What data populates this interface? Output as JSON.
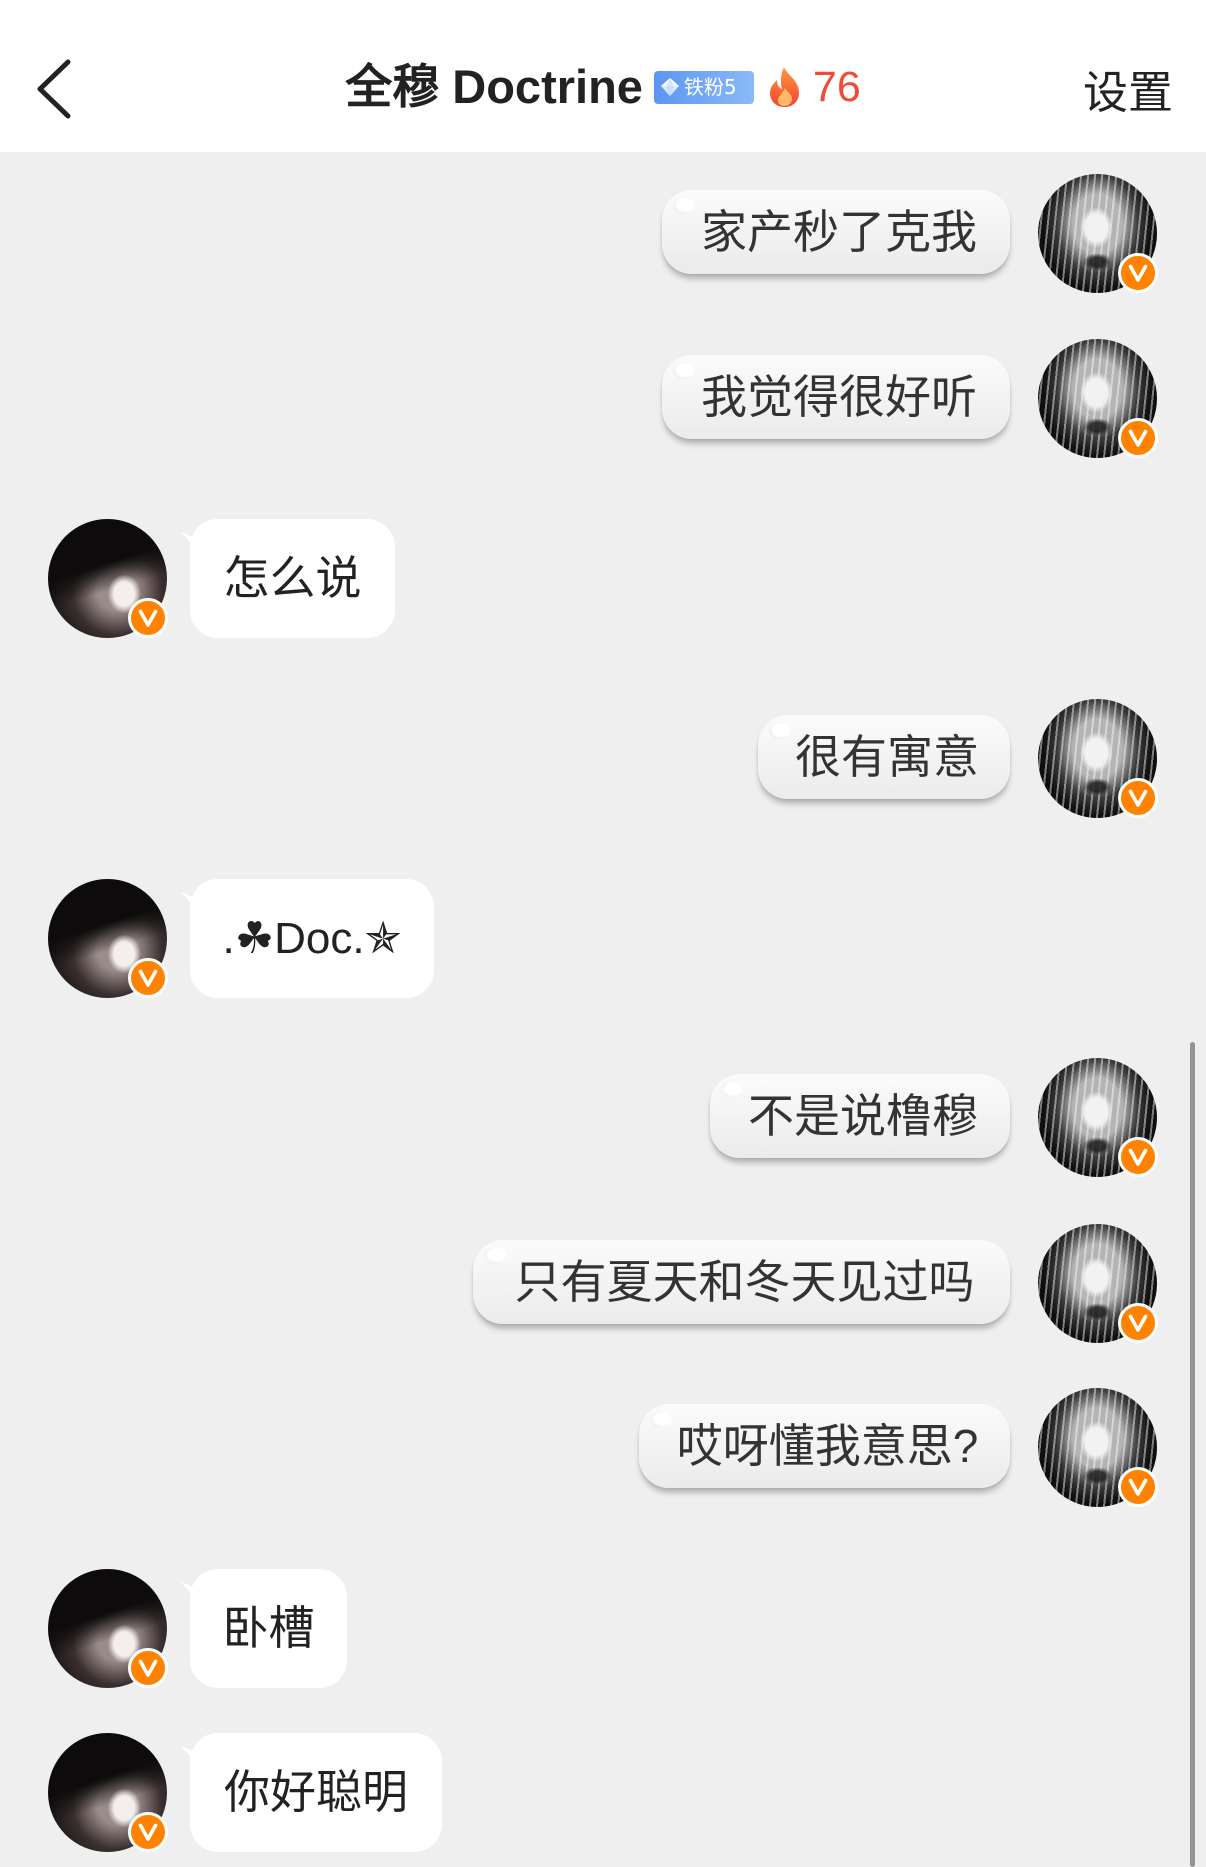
{
  "header": {
    "title": "全穆 Doctrine",
    "fan_badge": {
      "label": "铁粉5"
    },
    "fire_count": "76",
    "settings_label": "设置"
  },
  "messages": [
    {
      "text": "家产秒了克我"
    },
    {
      "text": "我觉得很好听"
    },
    {
      "text": "怎么说"
    },
    {
      "text": "很有寓意"
    },
    {
      "text": ".☘Doc.✯"
    },
    {
      "text": "不是说橹穆"
    },
    {
      "text": "只有夏天和冬天见过吗"
    },
    {
      "text": "哎呀懂我意思?"
    },
    {
      "text": "卧槽"
    },
    {
      "text": "你好聪明"
    }
  ],
  "icons": {
    "back": "chevron-left-icon",
    "fan_badge": "diamond-icon",
    "fire": "fire-icon",
    "verified": "verified-v-icon",
    "my_avatar": "anime-girl-avatar",
    "contact_avatar": "dark-hair-avatar"
  },
  "colors": {
    "header_bg": "#ffffff",
    "chat_bg": "#efefef",
    "fire_count": "#f04b3a",
    "fan_badge": "#5b97f0",
    "verified_badge": "#ff8200"
  }
}
